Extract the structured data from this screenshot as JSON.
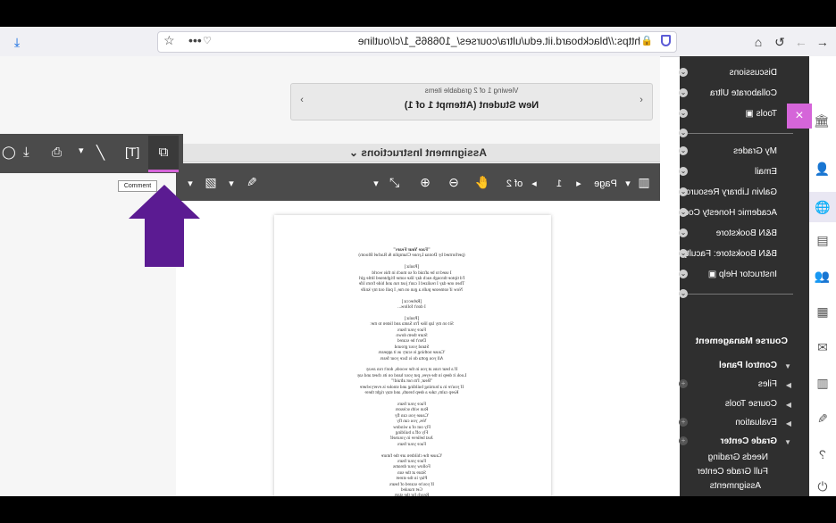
{
  "browser": {
    "url": "https://blackboard.iit.edu/ultra/courses/_106865_1/cl/outline",
    "back_icon": "arrow-left-icon",
    "forward_icon": "arrow-right-icon",
    "reload_icon": "reload-icon",
    "home_icon": "home-icon"
  },
  "course_menu": {
    "close_label": "×",
    "items": [
      {
        "label": "Discussions"
      },
      {
        "label": "Collaborate Ultra"
      },
      {
        "label": "Tools ▣"
      },
      {
        "label": "My Grades"
      },
      {
        "label": "Email"
      },
      {
        "label": "Galvin Library Resources"
      },
      {
        "label": "Academic Honesty Code"
      },
      {
        "label": "B&N Bookstore"
      },
      {
        "label": "B&N Bookstore: Faculty ▣"
      },
      {
        "label": "Instructor Help ▣"
      }
    ],
    "management_title": "Course Management",
    "control_panel": "Control Panel",
    "sub_items": [
      {
        "label": "Files"
      },
      {
        "label": "Course Tools"
      },
      {
        "label": "Evaluation"
      },
      {
        "label": "Grade Center"
      },
      {
        "label": "Needs Grading"
      },
      {
        "label": "Full Grade Center"
      },
      {
        "label": "Assignments"
      }
    ]
  },
  "grading": {
    "viewing_text": "Viewing 1 of 2 gradable items",
    "student_name": "New Student (Attempt 1 of 1)",
    "assignment_header": "Assignment Instructions",
    "page_label": "Page",
    "page_number": "1",
    "page_total": "of 2",
    "tooltip": "Comment"
  },
  "document": {
    "title": "\"Face Your Fears\"",
    "byline": "(performed by Donna Lynne Champlin & Rachel Bloom)",
    "lines": [
      "",
      "[Paula:]",
      "I used to be afraid of so much in this world",
      "I'd tiptoe through each day like some frightened little girl",
      "Then one day I realized I can't just run and hide from life",
      "Now if someone pulls a gun on me, I pull out my knife",
      "",
      "[Rebecca:]",
      "I don't follow...",
      "",
      "[Paula:]",
      "Sit on my lap like I'm Santa and listen to me:",
      "Face your fears",
      "Stare them down",
      "Don't be scared",
      "Stand your ground",
      "'Cause nothing is scary as it appears",
      "All you gotta do is face your fears",
      "",
      "If a bear runs at you in the woods, don't run away",
      "Look it deep in the eyes, put your hand on its chest and say",
      "\"Bear, I'm not afraid!\"",
      "If you're in a burning building and smoke is everywhere",
      "Keep calm, take a deep breath, and stay right there",
      "",
      "Face your fears",
      "Run with scissors",
      "'Cause you can fly",
      "Yes, you can fly",
      "Fly out of a window",
      "Fly off a building",
      "Just believe in yourself",
      "Face your fears",
      "",
      "'Cause the children are the future",
      "Face your fears",
      "Follow your dreams",
      "Stare at the sun",
      "Play in the street",
      "If you're scared of bears",
      "Get mauled",
      "Reach for the stars"
    ]
  }
}
